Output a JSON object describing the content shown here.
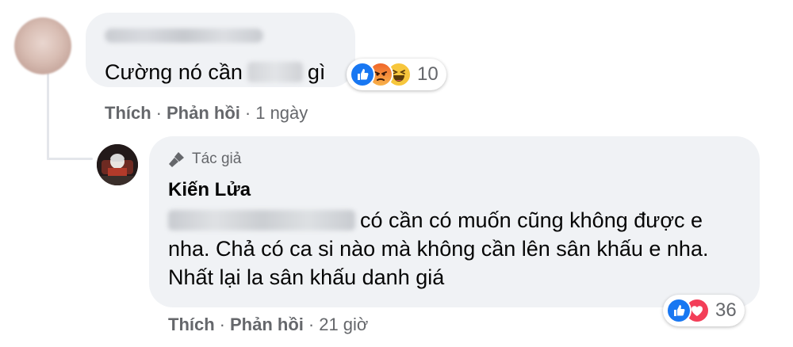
{
  "comment1": {
    "text_before": "Cường nó cần",
    "text_after": "gì",
    "reaction_icons": [
      "like-icon",
      "angry-icon",
      "haha-icon"
    ],
    "reaction_count": "10",
    "actions": {
      "like": "Thích",
      "reply": "Phản hồi",
      "time": "1 ngày"
    }
  },
  "reply": {
    "author_badge": "Tác giả",
    "author_name": "Kiến Lửa",
    "text": "có cần có muốn cũng không được e nha. Chả có ca si nào mà không cần lên sân khấu e nha. Nhất lại la sân khấu danh giá",
    "reaction_icons": [
      "like-icon",
      "love-icon"
    ],
    "reaction_count": "36",
    "actions": {
      "like": "Thích",
      "reply": "Phản hồi",
      "time": "21 giờ"
    }
  },
  "colors": {
    "bubble": "#f0f2f5",
    "secondary_text": "#65676b",
    "like_blue": "#1877f2",
    "love_red": "#f33e58"
  }
}
